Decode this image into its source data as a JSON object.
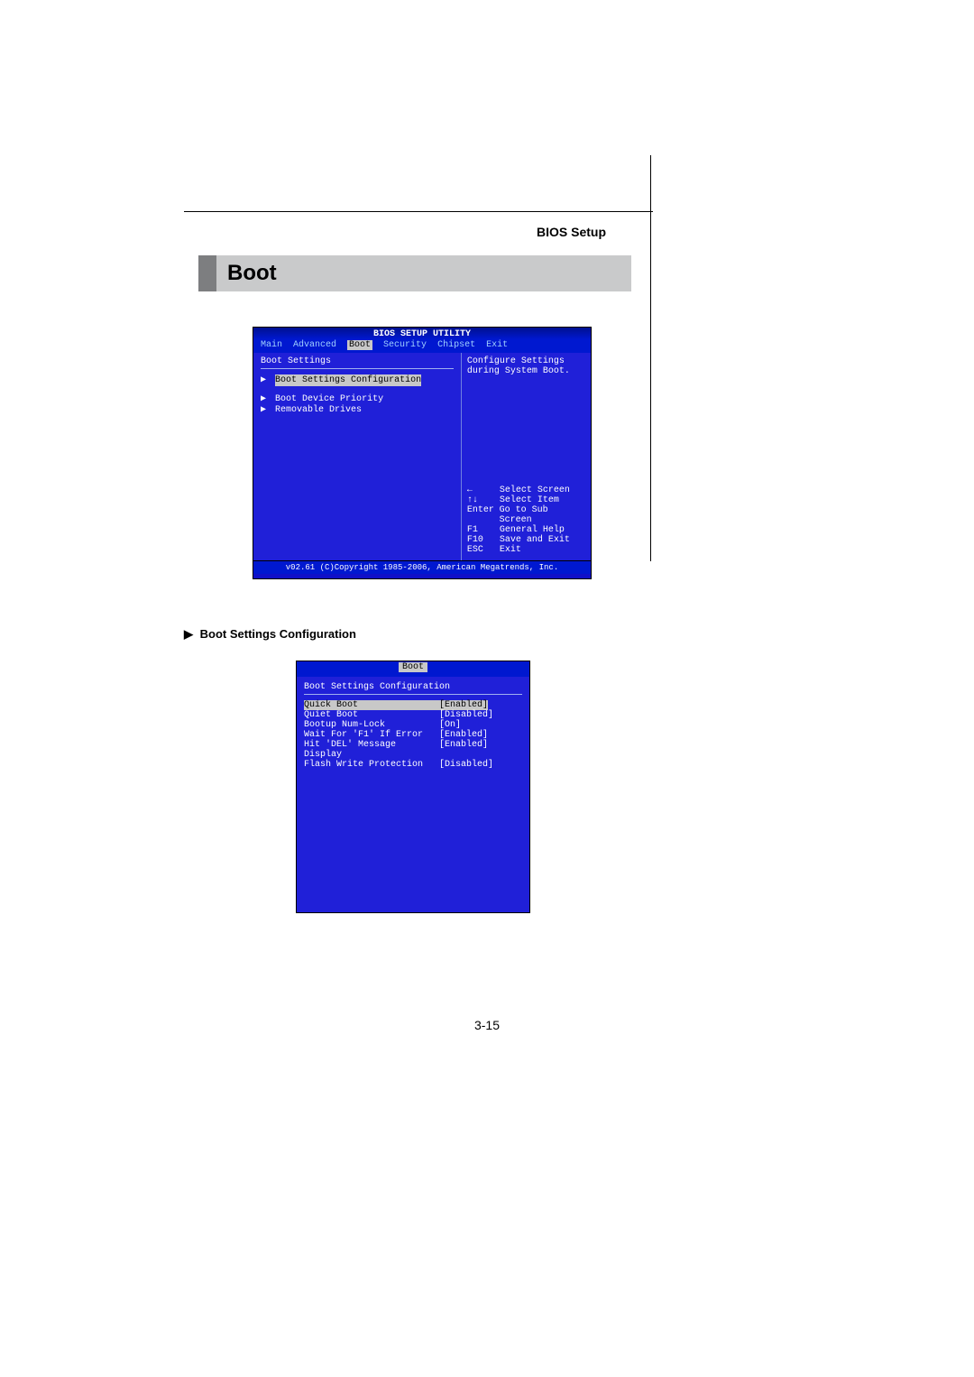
{
  "header": {
    "section_label": "BIOS Setup"
  },
  "banner": {
    "title": "Boot"
  },
  "bios1": {
    "title": "BIOS SETUP UTILITY",
    "tabs": [
      "Main",
      "Advanced",
      "Boot",
      "Security",
      "Chipset",
      "Exit"
    ],
    "active_tab": "Boot",
    "left_heading": "Boot Settings",
    "menu": [
      "Boot Settings Configuration",
      "Boot Device Priority",
      "Removable Drives"
    ],
    "help_line1": "Configure Settings",
    "help_line2": "during System Boot.",
    "keys": [
      {
        "k": "←",
        "d": "Select Screen"
      },
      {
        "k": "↑↓",
        "d": "Select Item"
      },
      {
        "k": "Enter",
        "d": "Go to Sub Screen"
      },
      {
        "k": "F1",
        "d": "General Help"
      },
      {
        "k": "F10",
        "d": "Save and Exit"
      },
      {
        "k": "ESC",
        "d": "Exit"
      }
    ],
    "footer": "v02.61 (C)Copyright 1985-2006, American Megatrends, Inc."
  },
  "subhead": {
    "arrow": "▶",
    "text": "Boot Settings Configuration"
  },
  "bios2": {
    "tab": "Boot",
    "heading": "Boot Settings Configuration",
    "rows": [
      {
        "label": "Quick Boot",
        "value": "[Enabled]"
      },
      {
        "label": "Quiet Boot",
        "value": "[Disabled]"
      },
      {
        "label": "Bootup Num-Lock",
        "value": "[On]"
      },
      {
        "label": "Wait For 'F1' If Error",
        "value": "[Enabled]"
      },
      {
        "label": "Hit 'DEL' Message Display",
        "value": "[Enabled]"
      },
      {
        "label": "Flash Write Protection",
        "value": "[Disabled]"
      }
    ]
  },
  "page_number": "3-15"
}
